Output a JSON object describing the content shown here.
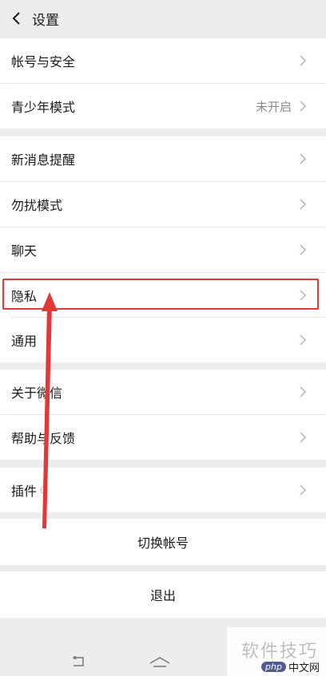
{
  "header": {
    "title": "设置"
  },
  "groups": [
    {
      "items": [
        {
          "label": "帐号与安全",
          "value": ""
        },
        {
          "label": "青少年模式",
          "value": "未开启"
        }
      ]
    },
    {
      "items": [
        {
          "label": "新消息提醒",
          "value": ""
        },
        {
          "label": "勿扰模式",
          "value": ""
        },
        {
          "label": "聊天",
          "value": ""
        },
        {
          "label": "隐私",
          "value": ""
        },
        {
          "label": "通用",
          "value": ""
        }
      ]
    },
    {
      "items": [
        {
          "label": "关于微信",
          "value": ""
        },
        {
          "label": "帮助与反馈",
          "value": ""
        }
      ]
    },
    {
      "items": [
        {
          "label": "插件",
          "value": ""
        }
      ]
    }
  ],
  "switch_account": "切换帐号",
  "logout": "退出",
  "watermark": {
    "text": "软件技巧",
    "site": "中文网",
    "badge": "php"
  },
  "colors": {
    "highlight": "#e2383a",
    "background": "#ededed",
    "row": "#ffffff"
  },
  "icons": [
    "chevron-left-icon",
    "chevron-right-icon",
    "plugin-dot-icon",
    "back-nav-icon",
    "home-nav-icon",
    "arrow-annotation"
  ]
}
